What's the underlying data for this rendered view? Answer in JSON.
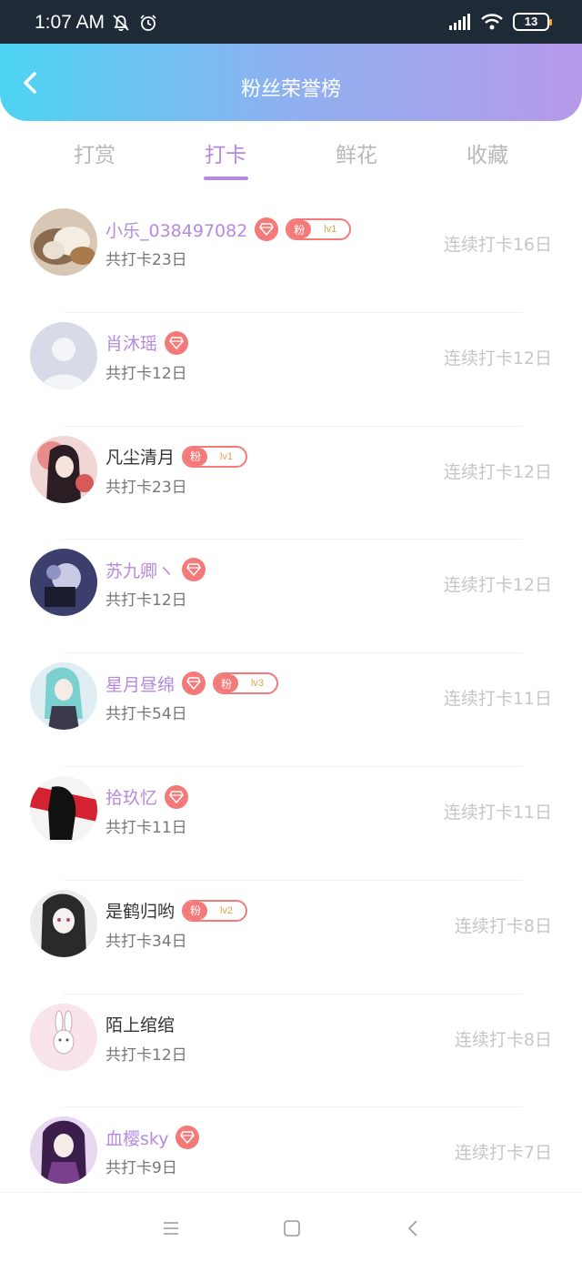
{
  "status": {
    "time": "1:07 AM",
    "battery": "13"
  },
  "header": {
    "title": "粉丝荣誉榜"
  },
  "tabs": [
    {
      "label": "打赏",
      "active": false
    },
    {
      "label": "打卡",
      "active": true
    },
    {
      "label": "鲜花",
      "active": false
    },
    {
      "label": "收藏",
      "active": false
    }
  ],
  "fans": [
    {
      "name": "小乐_038497082",
      "name_color": "purple",
      "diamond": true,
      "fan_level": "lv1",
      "total": "共打卡23日",
      "streak": "连续打卡16日",
      "avatar": "avatar-cat"
    },
    {
      "name": "肖沐瑶",
      "name_color": "purple",
      "diamond": true,
      "fan_level": null,
      "total": "共打卡12日",
      "streak": "连续打卡12日",
      "avatar": "avatar-default"
    },
    {
      "name": "凡尘清月",
      "name_color": "dark",
      "diamond": false,
      "fan_level": "lv1",
      "total": "共打卡23日",
      "streak": "连续打卡12日",
      "avatar": "avatar-anime-red"
    },
    {
      "name": "苏九卿ヽ",
      "name_color": "purple",
      "diamond": true,
      "fan_level": null,
      "total": "共打卡12日",
      "streak": "连续打卡12日",
      "avatar": "avatar-dark-blue"
    },
    {
      "name": "星月昼绵",
      "name_color": "purple",
      "diamond": true,
      "fan_level": "lv3",
      "total": "共打卡54日",
      "streak": "连续打卡11日",
      "avatar": "avatar-anime-teal"
    },
    {
      "name": "拾玖忆",
      "name_color": "purple",
      "diamond": true,
      "fan_level": null,
      "total": "共打卡11日",
      "streak": "连续打卡11日",
      "avatar": "avatar-red-black"
    },
    {
      "name": "是鹤归哟",
      "name_color": "dark",
      "diamond": false,
      "fan_level": "lv2",
      "total": "共打卡34日",
      "streak": "连续打卡8日",
      "avatar": "avatar-anime-mono"
    },
    {
      "name": "陌上绾绾",
      "name_color": "dark",
      "diamond": false,
      "fan_level": null,
      "total": "共打卡12日",
      "streak": "连续打卡8日",
      "avatar": "avatar-bunny"
    },
    {
      "name": "血樱sky",
      "name_color": "purple",
      "diamond": true,
      "fan_level": null,
      "total": "共打卡9日",
      "streak": "连续打卡7日",
      "avatar": "avatar-anime-purple"
    }
  ],
  "fan_badge_label": "粉",
  "colors": {
    "accent": "#b58ae0",
    "badge": "#f47a7a",
    "header_start": "#4cd4f2",
    "header_end": "#b699ea"
  }
}
